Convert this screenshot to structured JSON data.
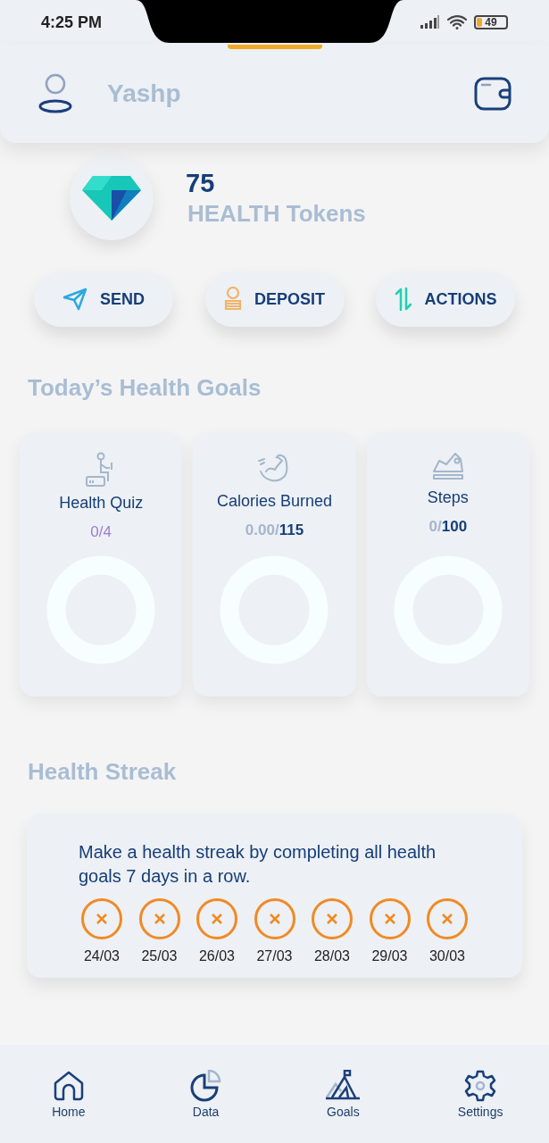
{
  "status_bar": {
    "time": "4:25 PM",
    "battery": "49"
  },
  "header": {
    "username": "Yashp"
  },
  "tokens": {
    "amount": "75",
    "label": "HEALTH Tokens"
  },
  "actions": [
    {
      "kind": "send",
      "label": "SEND"
    },
    {
      "kind": "deposit",
      "label": "DEPOSIT"
    },
    {
      "kind": "actions",
      "label": "ACTIONS"
    }
  ],
  "goals_title": "Today’s Health Goals",
  "goals": [
    {
      "kind": "quiz",
      "title": "Health Quiz",
      "done": "0/",
      "target": "4"
    },
    {
      "kind": "calories",
      "title": "Calories Burned",
      "done": "0.00/",
      "target": "115"
    },
    {
      "kind": "steps",
      "title": "Steps",
      "done": "0/",
      "target": "100"
    }
  ],
  "streak": {
    "title": "Health Streak",
    "description": "Make a health streak by completing all health goals 7 days in a row.",
    "days": [
      {
        "date": "24/03",
        "completed": false
      },
      {
        "date": "25/03",
        "completed": false
      },
      {
        "date": "26/03",
        "completed": false
      },
      {
        "date": "27/03",
        "completed": false
      },
      {
        "date": "28/03",
        "completed": false
      },
      {
        "date": "29/03",
        "completed": false
      },
      {
        "date": "30/03",
        "completed": false
      }
    ]
  },
  "nav": [
    {
      "kind": "home",
      "label": "Home"
    },
    {
      "kind": "data",
      "label": "Data"
    },
    {
      "kind": "goals",
      "label": "Goals"
    },
    {
      "kind": "settings",
      "label": "Settings"
    }
  ]
}
